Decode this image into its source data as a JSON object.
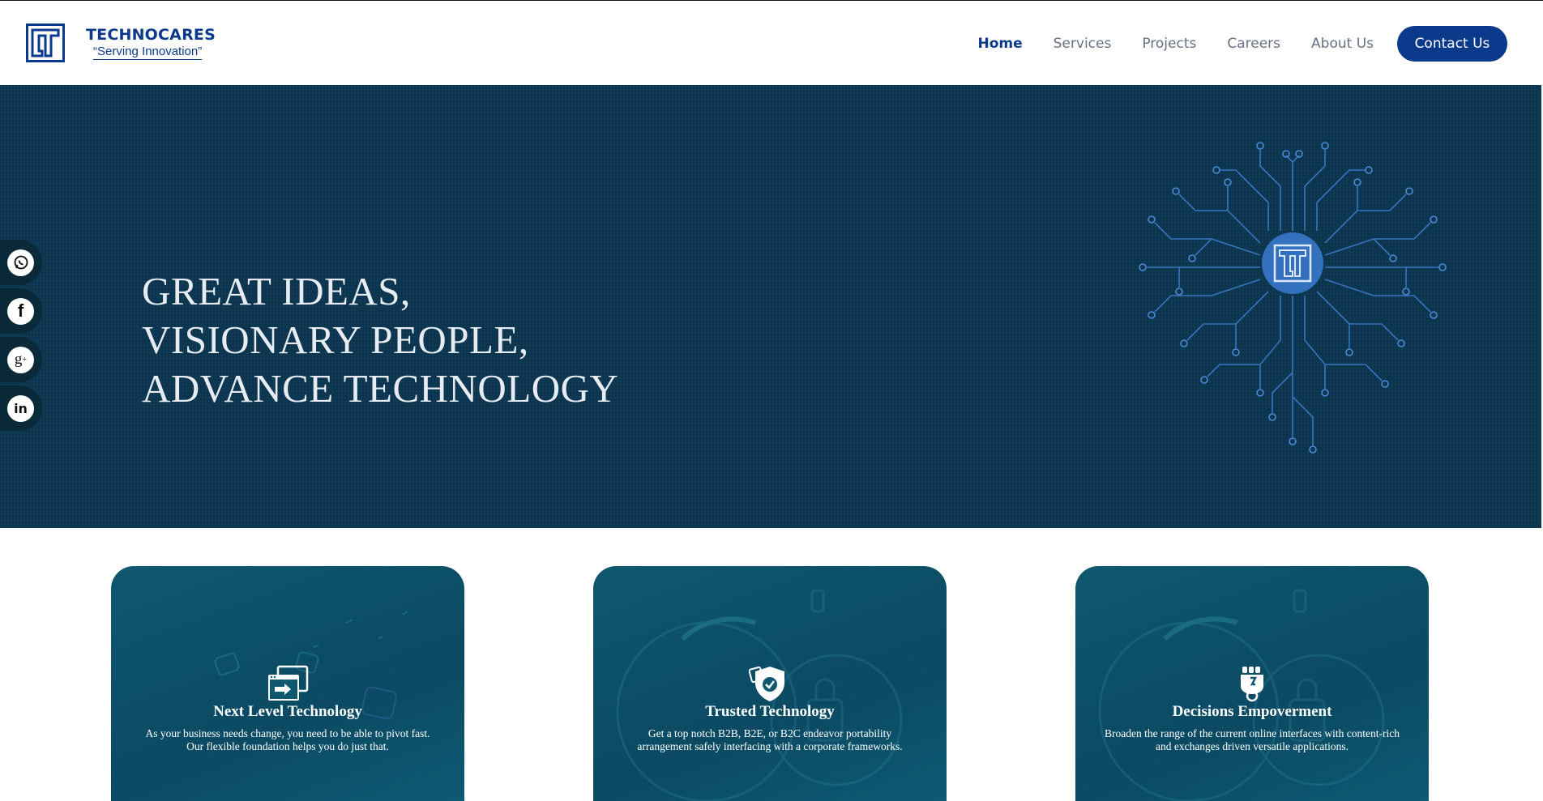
{
  "header": {
    "logo_name": "TECHNOCARES",
    "logo_tagline": "“Serving Innovation”",
    "nav": [
      {
        "label": "Home",
        "active": true
      },
      {
        "label": "Services",
        "active": false
      },
      {
        "label": "Projects",
        "active": false
      },
      {
        "label": "Careers",
        "active": false
      },
      {
        "label": "About Us",
        "active": false
      }
    ],
    "contact_label": "Contact Us"
  },
  "hero": {
    "lines": [
      "GREAT IDEAS,",
      "VISIONARY PEOPLE,",
      "ADVANCE TECHNOLOGY"
    ]
  },
  "social": [
    {
      "icon": "whatsapp-icon"
    },
    {
      "icon": "facebook-icon"
    },
    {
      "icon": "google-plus-icon"
    },
    {
      "icon": "linkedin-icon"
    }
  ],
  "cards": [
    {
      "icon": "browser-windows-icon",
      "title": "Next Level Technology",
      "desc_lines": [
        "As your business needs change, you need to be able to pivot fast.",
        "Our flexible foundation helps you do just that."
      ]
    },
    {
      "icon": "shield-check-icon",
      "title": "Trusted Technology",
      "desc_lines": [
        "Get a top notch B2B, B2E, or B2C endeavor portability",
        "arrangement safely interfacing with a corporate frameworks."
      ]
    },
    {
      "icon": "fist-gear-icon",
      "title": "Decisions Empoverment",
      "desc_lines": [
        "Broaden the range of the current online interfaces with content-rich",
        "and exchanges driven versatile applications."
      ]
    }
  ],
  "colors": {
    "brand": "#0b3a8c",
    "hero_bg": "#0c3550",
    "card_bg": "#0b4a62"
  }
}
